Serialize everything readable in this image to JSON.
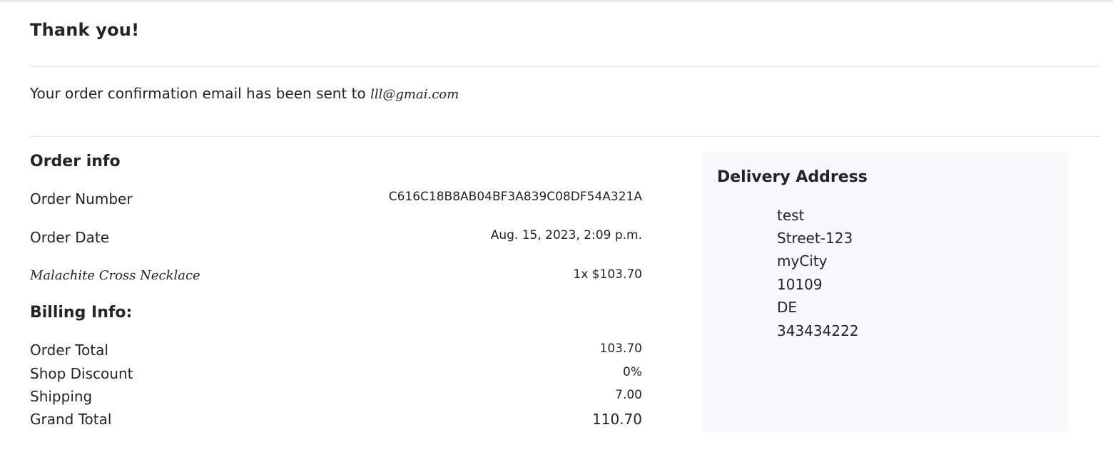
{
  "header": {
    "title": "Thank you!"
  },
  "confirmation": {
    "text": "Your order confirmation email has been sent to ",
    "email": "lll@gmai.com"
  },
  "order_info": {
    "title": "Order info",
    "order_number_label": "Order Number",
    "order_number": "C616C18B8AB04BF3A839C08DF54A321A",
    "order_date_label": "Order Date",
    "order_date": "Aug. 15, 2023, 2:09 p.m.",
    "items": [
      {
        "name": "Malachite Cross Necklace",
        "qty_price": "1x $103.70"
      }
    ]
  },
  "billing_info": {
    "title": "Billing Info:",
    "order_total_label": "Order Total",
    "order_total": "103.70",
    "shop_discount_label": "Shop Discount",
    "shop_discount": "0%",
    "shipping_label": "Shipping",
    "shipping": "7.00",
    "grand_total_label": "Grand Total",
    "grand_total": "110.70"
  },
  "delivery_address": {
    "title": "Delivery Address",
    "lines": [
      "test",
      "Street-123",
      "myCity",
      "10109",
      "DE",
      "343434222"
    ]
  }
}
